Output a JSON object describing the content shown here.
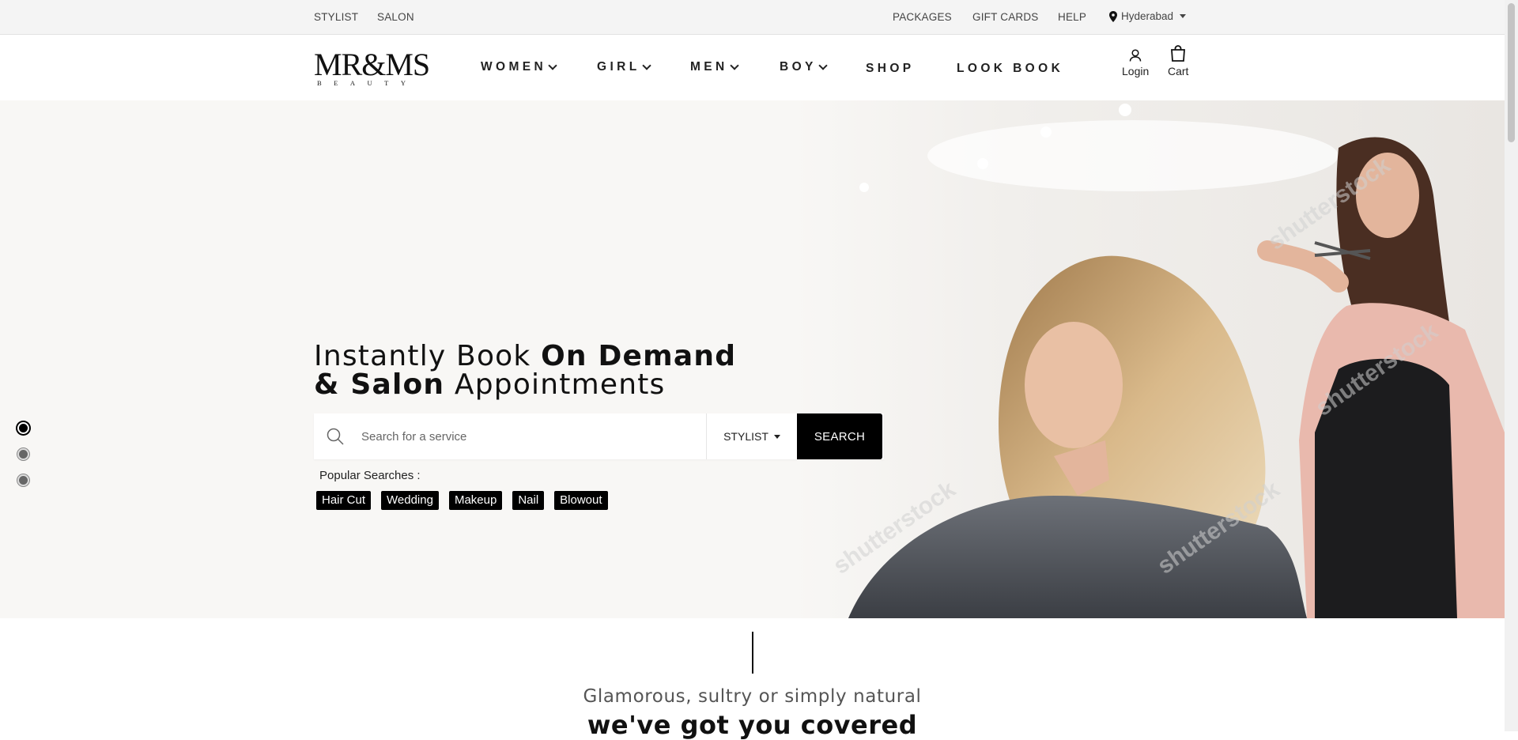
{
  "topbar": {
    "left_links": [
      "STYLIST",
      "SALON"
    ],
    "right_links": [
      "PACKAGES",
      "GIFT CARDS",
      "HELP"
    ],
    "location": "Hyderabad"
  },
  "logo": {
    "brand": "MR&MS",
    "sub": "BEAUTY"
  },
  "nav": {
    "items": [
      {
        "label": "WOMEN",
        "dropdown": true
      },
      {
        "label": "GIRL",
        "dropdown": true
      },
      {
        "label": "MEN",
        "dropdown": true
      },
      {
        "label": "BOY",
        "dropdown": true
      },
      {
        "label": "SHOP",
        "dropdown": false
      },
      {
        "label": "LOOK BOOK",
        "dropdown": false
      }
    ],
    "login_label": "Login",
    "cart_label": "Cart"
  },
  "hero": {
    "headline_part1": "Instantly Book ",
    "headline_bold1": "On Demand",
    "headline_bold2": "& Salon",
    "headline_part2": " Appointments",
    "search_placeholder": "Search for a service",
    "search_type": "STYLIST",
    "search_button": "SEARCH",
    "popular_label": "Popular Searches :",
    "popular_tags": [
      "Hair Cut",
      "Wedding",
      "Makeup",
      "Nail",
      "Blowout"
    ],
    "slides_total": 3,
    "active_slide": 1
  },
  "section": {
    "tagline": "Glamorous, sultry or simply natural",
    "heading": "we've got you covered"
  },
  "colors": {
    "hero_bg": "#f8f7f5",
    "button_bg": "#000000",
    "topbar_bg": "#f4f4f4"
  }
}
